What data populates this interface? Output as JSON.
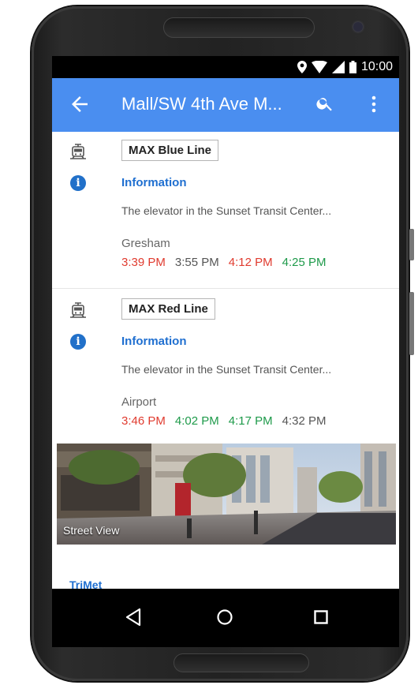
{
  "status_bar": {
    "time": "10:00"
  },
  "app_bar": {
    "title": "Mall/SW 4th Ave M..."
  },
  "departures": [
    {
      "line": "MAX Blue Line",
      "info_title": "Information",
      "info_text": "The elevator in the Sunset Transit Center...",
      "destination": "Gresham",
      "times": [
        {
          "label": "3:39 PM",
          "status": "red"
        },
        {
          "label": "3:55 PM",
          "status": "grey"
        },
        {
          "label": "4:12 PM",
          "status": "red"
        },
        {
          "label": "4:25 PM",
          "status": "green"
        }
      ]
    },
    {
      "line": "MAX Red Line",
      "info_title": "Information",
      "info_text": "The elevator in the Sunset Transit Center...",
      "destination": "Airport",
      "times": [
        {
          "label": "3:46 PM",
          "status": "red"
        },
        {
          "label": "4:02 PM",
          "status": "green"
        },
        {
          "label": "4:17 PM",
          "status": "green"
        },
        {
          "label": "4:32 PM",
          "status": "grey"
        }
      ]
    }
  ],
  "street_view": {
    "label": "Street View"
  },
  "agency": {
    "name": "TriMet"
  },
  "colors": {
    "app_bar": "#4a8ef0",
    "link_blue": "#1f6fd0",
    "late_red": "#e03b2f",
    "ontime_green": "#1e9a4a"
  },
  "icons": {
    "back": "arrow-left-icon",
    "search": "search-icon",
    "more": "more-vert-icon",
    "tram": "tram-icon",
    "info": "info-icon",
    "nav_back": "triangle-back-icon",
    "nav_home": "circle-home-icon",
    "nav_recent": "square-recents-icon"
  }
}
